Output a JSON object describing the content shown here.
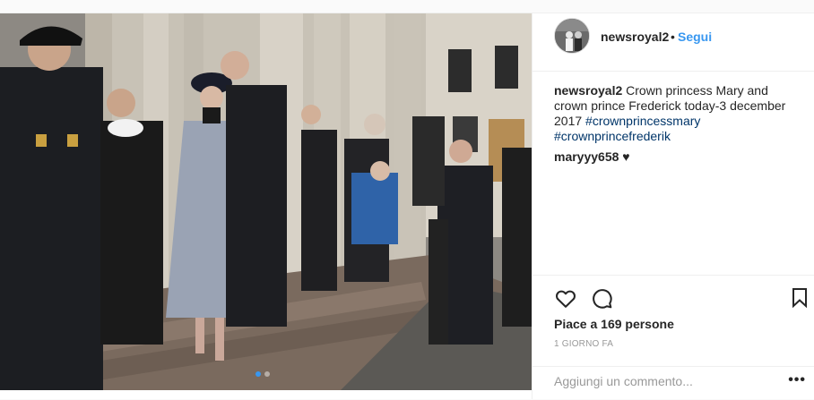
{
  "header": {
    "username": "newsroyal2",
    "separator": "•",
    "follow_label": "Segui"
  },
  "caption": {
    "username": "newsroyal2",
    "text": " Crown princess Mary and crown prince Frederick today-3 december 2017 ",
    "hashtags": [
      "#crownprincessmary",
      "#crownprincefrederik"
    ]
  },
  "comments": [
    {
      "username": "maryyy658",
      "text": " ♥"
    }
  ],
  "actions": {
    "like_icon": "heart-icon",
    "comment_icon": "comment-icon",
    "save_icon": "bookmark-icon"
  },
  "likes_text": "Piace a 169 persone",
  "timestamp": "1 GIORNO FA",
  "add_comment": {
    "placeholder": "Aggiungi un commento...",
    "more_label": "•••"
  },
  "carousel": {
    "count": 2,
    "active_index": 0
  },
  "colors": {
    "accent": "#3897f0",
    "hashtag": "#003569",
    "border": "#efefef"
  }
}
